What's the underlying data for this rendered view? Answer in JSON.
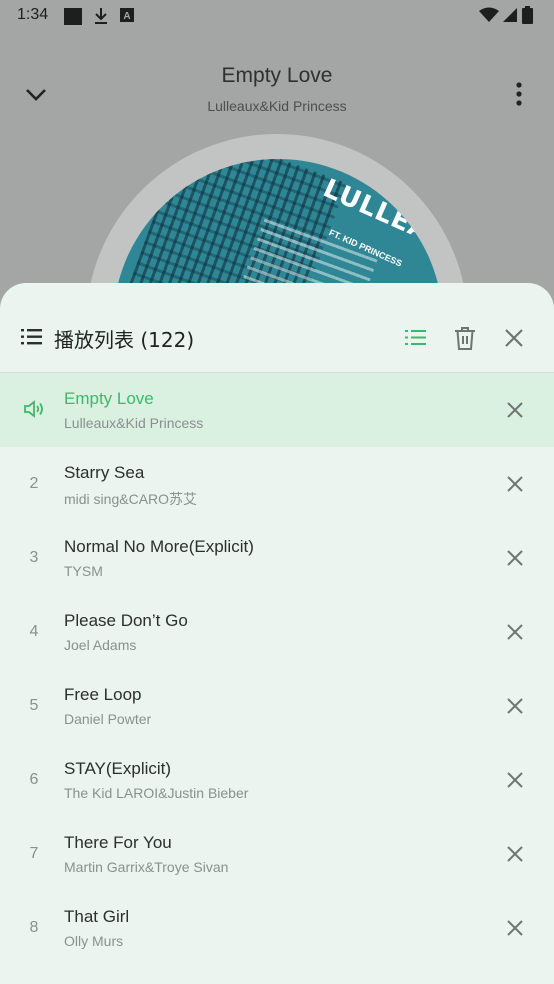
{
  "status_bar": {
    "time": "1:34",
    "icons": [
      "square-notification-icon",
      "download-icon",
      "text-a-icon",
      "wifi-icon",
      "signal-icon",
      "battery-icon"
    ]
  },
  "player": {
    "title": "Empty Love",
    "artist": "Lulleaux&Kid Princess",
    "album_art_text": "LULLEAUX",
    "album_art_subtext": "FT. KID PRINCESS"
  },
  "playlist": {
    "title": "播放列表 (122)",
    "tracks": [
      {
        "index": "",
        "title": "Empty Love",
        "artist": "Lulleaux&Kid Princess",
        "playing": true
      },
      {
        "index": "2",
        "title": "Starry Sea",
        "artist": "midi sing&CARO苏艾"
      },
      {
        "index": "3",
        "title": "Normal No More(Explicit)",
        "artist": "TYSM"
      },
      {
        "index": "4",
        "title": "Please Don’t Go",
        "artist": "Joel Adams"
      },
      {
        "index": "5",
        "title": "Free Loop",
        "artist": "Daniel Powter"
      },
      {
        "index": "6",
        "title": "STAY(Explicit)",
        "artist": "The Kid LAROI&Justin Bieber"
      },
      {
        "index": "7",
        "title": "There For You",
        "artist": "Martin Garrix&Troye Sivan"
      },
      {
        "index": "8",
        "title": "That Girl",
        "artist": "Olly Murs"
      }
    ]
  },
  "colors": {
    "accent": "#3db86b",
    "sheet_background": "#ecf4ef",
    "active_row": "#daf0e1",
    "backdrop": "#a3a6a4"
  }
}
